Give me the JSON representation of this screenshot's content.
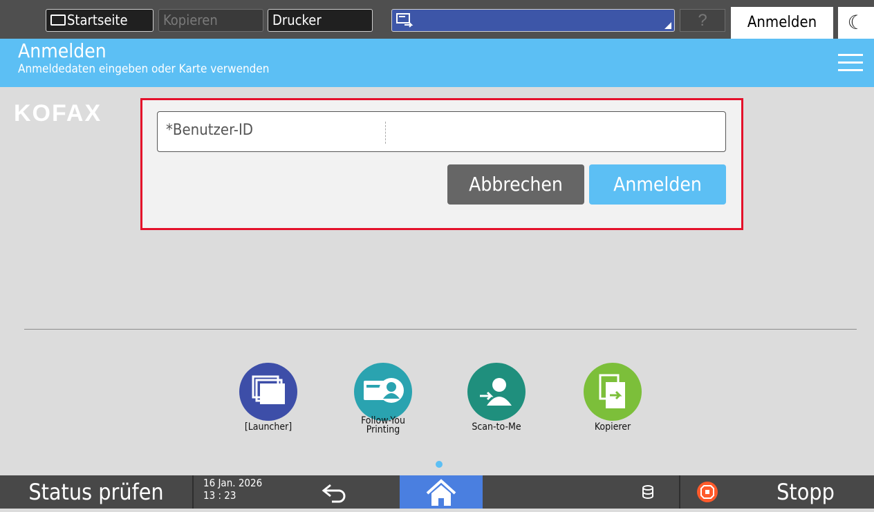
{
  "topbar": {
    "home_label": "Startseite",
    "copy_label": "Kopieren",
    "printer_label": "Drucker",
    "help_label": "?",
    "login_label": "Anmelden"
  },
  "header": {
    "title": "Anmelden",
    "subtitle": "Anmeldedaten eingeben oder Karte verwenden"
  },
  "brand": "KOFAX",
  "login": {
    "userid_label": "*Benutzer-ID",
    "cancel_label": "Abbrechen",
    "submit_label": "Anmelden"
  },
  "apps": [
    {
      "label": "[Launcher]",
      "color": "#3d4ea8"
    },
    {
      "label": "Follow-You Printing",
      "line1": "Follow-You",
      "line2": "Printing",
      "color": "#2aa3b0"
    },
    {
      "label": "Scan-to-Me",
      "color": "#1f8f7d"
    },
    {
      "label": "Kopierer",
      "color": "#7cbf3a"
    }
  ],
  "bottombar": {
    "status_label": "Status prüfen",
    "date": "16 Jan. 2026",
    "time": "13 : 23",
    "stop_label": "Stopp"
  },
  "colors": {
    "header_blue": "#5cbff4",
    "highlight_red": "#e4102a",
    "home_active": "#4a7fe0"
  }
}
